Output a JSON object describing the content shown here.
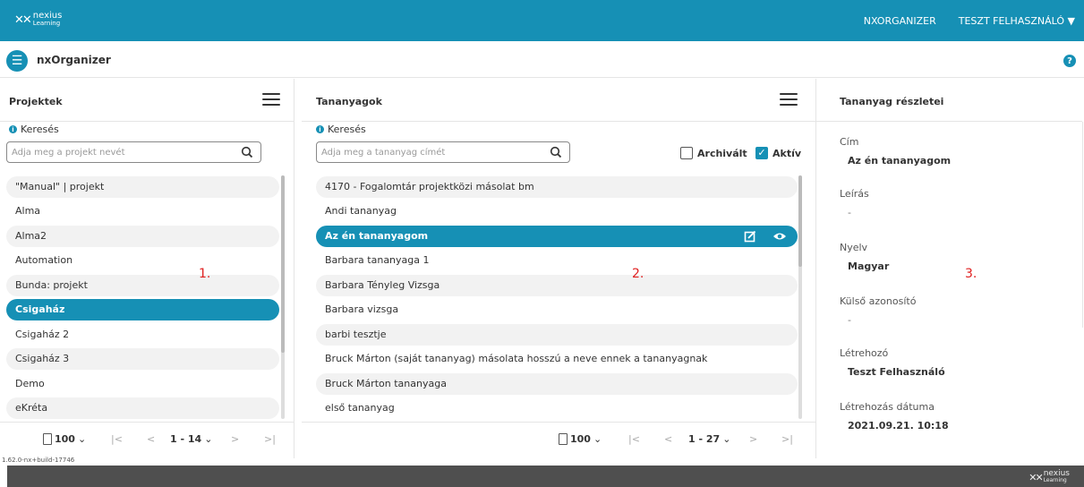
{
  "topbar": {
    "logo_line1": "nexius",
    "logo_line2": "Learning",
    "nav_items": [
      "NXORGANIZER",
      "TESZT FELHASZNÁLÓ"
    ],
    "accent_color": "#1690b5"
  },
  "subbar": {
    "app_title": "nxOrganizer",
    "help_label": "?"
  },
  "projects": {
    "title": "Projektek",
    "search_label": "Keresés",
    "search_placeholder": "Adja meg a projekt nevét",
    "items": [
      "\"Manual\" | projekt",
      "Alma",
      "Alma2",
      "Automation",
      "Bunda: projekt",
      "Csigaház",
      "Csigaház 2",
      "Csigaház 3",
      "Demo",
      "eKréta"
    ],
    "selected_index": 5,
    "page_size": "100",
    "range": "1 - 14",
    "annotation": "1."
  },
  "materials": {
    "title": "Tananyagok",
    "search_label": "Keresés",
    "search_placeholder": "Adja meg a tananyag címét",
    "archived_label": "Archivált",
    "archived_checked": false,
    "active_label": "Aktív",
    "active_checked": true,
    "items": [
      "4170 - Fogalomtár projektközi másolat bm",
      "Andi tananyag",
      "Az én tananyagom",
      "Barbara tananyaga 1",
      "Barbara Tényleg Vizsga",
      "Barbara vizsga",
      "barbi tesztje",
      "Bruck Márton (saját tananyag) másolata hosszú a neve ennek a tananyagnak",
      "Bruck Márton tananyaga",
      "első tananyag"
    ],
    "selected_index": 2,
    "page_size": "100",
    "range": "1 - 27",
    "annotation": "2."
  },
  "details": {
    "title": "Tananyag részletei",
    "fields": [
      {
        "label": "Cím",
        "value": "Az én tananyagom"
      },
      {
        "label": "Leírás",
        "value": "-"
      },
      {
        "label": "Nyelv",
        "value": "Magyar"
      },
      {
        "label": "Külső azonosító",
        "value": "-"
      },
      {
        "label": "Létrehozó",
        "value": "Teszt Felhasználó"
      },
      {
        "label": "Létrehozás dátuma",
        "value": "2021.09.21. 10:18"
      }
    ],
    "annotation": "3."
  },
  "build": "1.62.0-nx+build-17746",
  "footer": {
    "logo_line1": "nexius",
    "logo_line2": "Learning"
  }
}
